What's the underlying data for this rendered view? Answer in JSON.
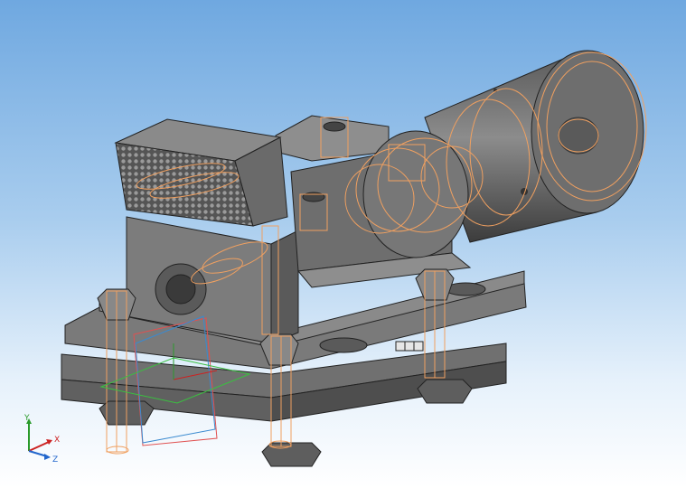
{
  "viewport": {
    "background_top": "#6fa8e0",
    "background_bottom": "#ffffff",
    "model_color": "#6a6a6a",
    "wireframe_color": "#f0a060"
  },
  "triad": {
    "y_label": "Y",
    "x_label": "X",
    "z_label": "Z",
    "x_color": "#cc2222",
    "y_color": "#2a9a2a",
    "z_color": "#2266cc"
  }
}
